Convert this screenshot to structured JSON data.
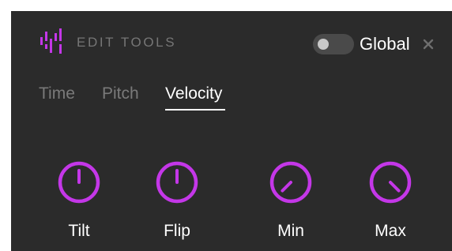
{
  "colors": {
    "panel_bg": "#2b2b2b",
    "accent": "#c437e8",
    "muted_text": "#7a7a7a",
    "active_text": "#ffffff"
  },
  "header": {
    "logo_icon": "waveform-bars-icon",
    "title": "EDIT TOOLS",
    "global_toggle": {
      "label": "Global",
      "on": false
    },
    "close_icon": "close-icon"
  },
  "tabs": [
    {
      "label": "Time",
      "active": false
    },
    {
      "label": "Pitch",
      "active": false
    },
    {
      "label": "Velocity",
      "active": true
    }
  ],
  "knobs": [
    {
      "label": "Tilt",
      "angle_deg": 0
    },
    {
      "label": "Flip",
      "angle_deg": 0
    },
    {
      "label": "Min",
      "angle_deg": -135
    },
    {
      "label": "Max",
      "angle_deg": 135
    }
  ]
}
